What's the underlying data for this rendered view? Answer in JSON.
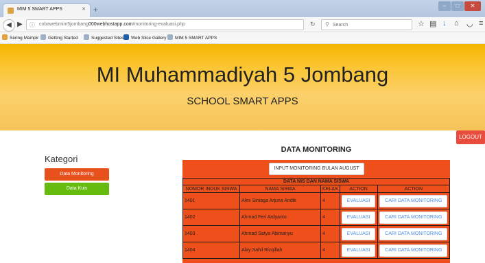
{
  "browser": {
    "tab_title": "MIM 5 SMART APPS",
    "tab_close": "×",
    "new_tab": "+",
    "url_host": "cobawebmim5jombang",
    "url_domain": "000webhostapp.com",
    "url_path": "/monitoring-evaluasi.php",
    "search_placeholder": "Search",
    "bookmarks": [
      "Sering Mampir",
      "Getting Started",
      "Suggested Sites",
      "Web Slice Gallery",
      "MIM 5 SMART APPS"
    ]
  },
  "header": {
    "title": "MI Muhammadiyah 5 Jombang",
    "subtitle": "SCHOOL SMART APPS",
    "logout_label": "LOGOUT"
  },
  "sidebar": {
    "heading": "Kategori",
    "items": [
      {
        "label": "Data Monitoring",
        "color": "#e8501c"
      },
      {
        "label": "Data Kuis",
        "color": "#66bb0f"
      }
    ]
  },
  "main": {
    "title": "DATA MONITORING",
    "input_button": "INPUT MONITORING BULAN AUGUST",
    "table_caption": "DATA NIS DAN NAMA SISWA",
    "columns": [
      "NOMOR INDUK SISWA",
      "NAMA SISWA",
      "KELAS",
      "ACTION",
      "ACTION"
    ],
    "rows": [
      {
        "nis": "1401",
        "name": "Alex Siniaga Arjuna Andik",
        "kelas": "4",
        "eval": "EVALUASI",
        "cari": "CARI DATA MONITORING"
      },
      {
        "nis": "1402",
        "name": "Ahmad Feri Ardyanto",
        "kelas": "4",
        "eval": "EVALUASI",
        "cari": "CARI DATA MONITORING"
      },
      {
        "nis": "1403",
        "name": "Ahmad Satya Abimanyu",
        "kelas": "4",
        "eval": "EVALUASI",
        "cari": "CARI DATA MONITORING"
      },
      {
        "nis": "1404",
        "name": "Alay Sahil Rizqillah",
        "kelas": "4",
        "eval": "EVALUASI",
        "cari": "CARI DATA MONITORING"
      }
    ]
  },
  "colors": {
    "accent": "#ef4f1a",
    "banner": "#fbc531",
    "logout": "#e74c3c"
  }
}
